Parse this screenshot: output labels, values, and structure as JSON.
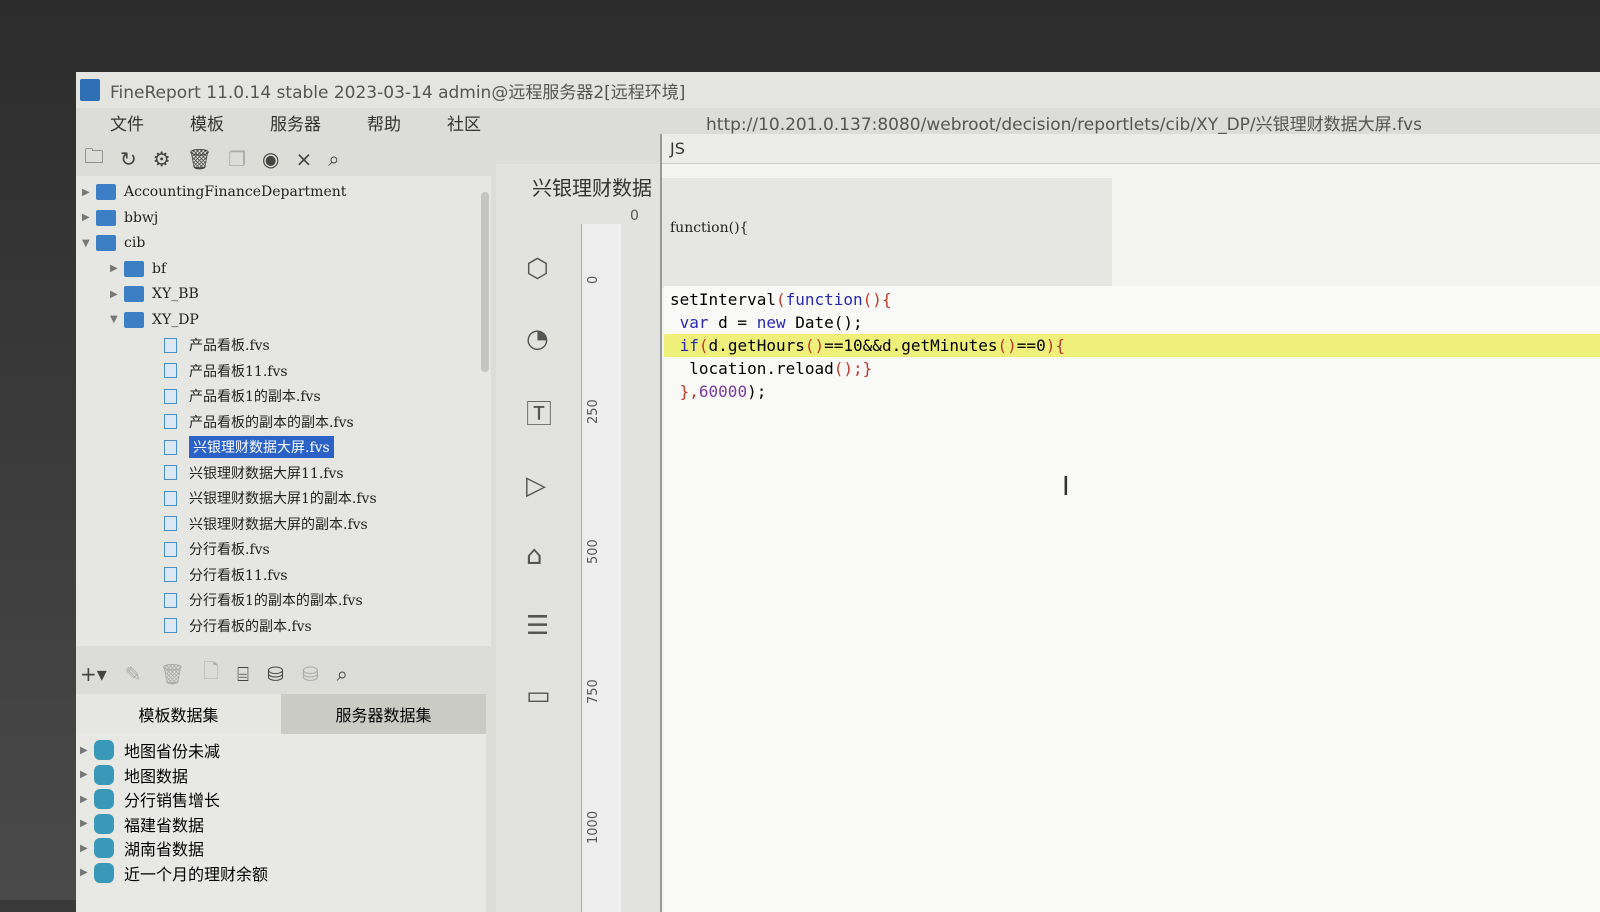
{
  "window": {
    "title": "FineReport 11.0.14 stable 2023-03-14 admin@远程服务器2[远程环境]",
    "url": "http://10.201.0.137:8080/webroot/decision/reportlets/cib/XY_DP/兴银理财数据大屏.fvs"
  },
  "menu": [
    "文件",
    "模板",
    "服务器",
    "帮助",
    "社区"
  ],
  "toolbar_icons": [
    "new-folder-icon",
    "refresh-icon",
    "settings-icon",
    "delete-icon",
    "copy-icon",
    "locate-icon",
    "collapse-icon",
    "search-icon"
  ],
  "tree": {
    "folders": [
      {
        "label": "AccountingFinanceDepartment",
        "level": 0,
        "open": false
      },
      {
        "label": "bbwj",
        "level": 0,
        "open": false
      },
      {
        "label": "cib",
        "level": 0,
        "open": true
      },
      {
        "label": "bf",
        "level": 1,
        "open": false
      },
      {
        "label": "XY_BB",
        "level": 1,
        "open": false
      },
      {
        "label": "XY_DP",
        "level": 1,
        "open": true
      }
    ],
    "files": [
      "产品看板.fvs",
      "产品看板11.fvs",
      "产品看板1的副本.fvs",
      "产品看板的副本的副本.fvs",
      "兴银理财数据大屏.fvs",
      "兴银理财数据大屏11.fvs",
      "兴银理财数据大屏1的副本.fvs",
      "兴银理财数据大屏的副本.fvs",
      "分行看板.fvs",
      "分行看板11.fvs",
      "分行看板1的副本的副本.fvs",
      "分行看板的副本.fvs"
    ],
    "selected": "兴银理财数据大屏.fvs"
  },
  "dataset": {
    "tabs": [
      "模板数据集",
      "服务器数据集"
    ],
    "items": [
      "地图省份未减",
      "地图数据",
      "分行销售增长",
      "福建省数据",
      "湖南省数据",
      "近一个月的理财余额"
    ]
  },
  "designer": {
    "title": "兴银理财数据",
    "ruler": [
      "0",
      "250",
      "500",
      "750",
      "1000"
    ],
    "top_ruler": "0"
  },
  "js_dialog": {
    "title": "JS",
    "wrapper": "function(){",
    "code": {
      "l1a": "setInterval",
      "l1b": "(",
      "l1c": "function",
      "l1d": "(){",
      "l2a": " var",
      "l2b": " d = ",
      "l2c": "new",
      "l2d": " Date",
      "l2e": "();",
      "l3a": " if",
      "l3b": "(",
      "l3c": "d.getHours",
      "l3d": "()",
      "l3e": "==10&&d.getMinutes",
      "l3f": "()",
      "l3g": "==0",
      "l3h": "){",
      "l4a": "  location.reload",
      "l4b": "();}",
      "l5a": " },",
      "l5b": "60000",
      "l5c": ");"
    }
  }
}
